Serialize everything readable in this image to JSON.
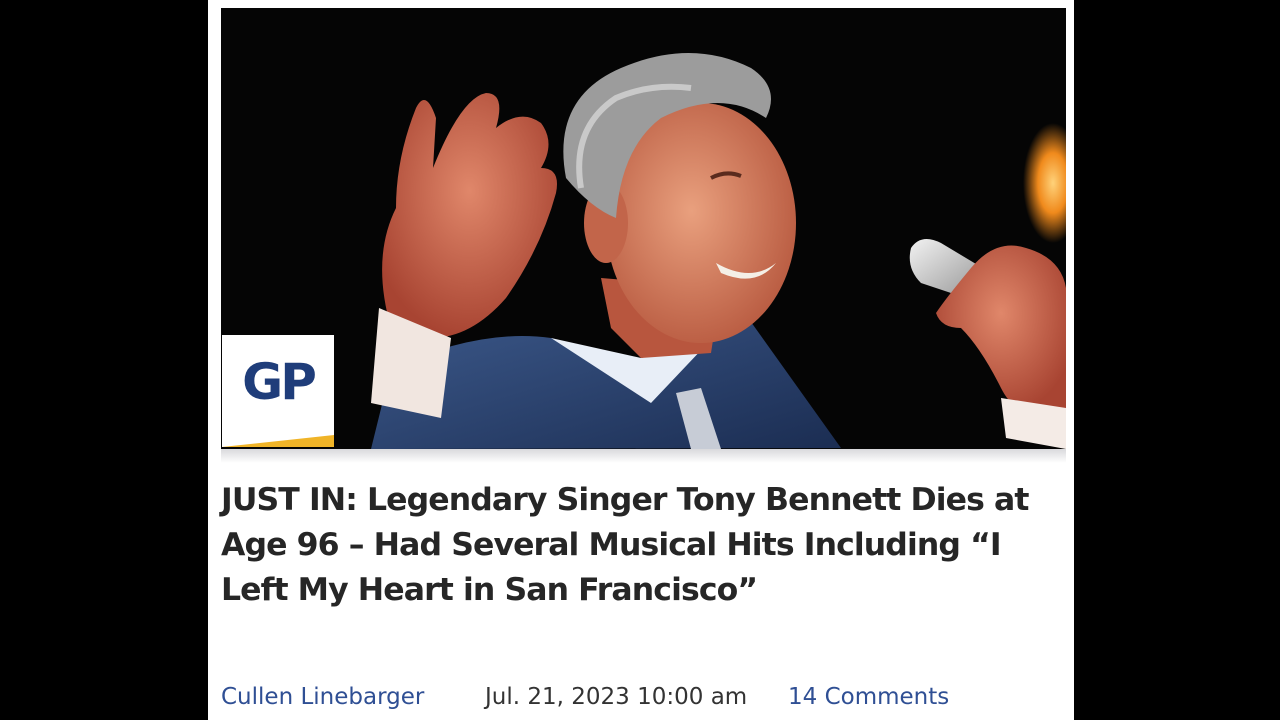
{
  "site": {
    "logo_text": "GP"
  },
  "article": {
    "headline": "JUST IN: Legendary Singer Tony Bennett Dies at Age 96 – Had Several Musical Hits Including “I Left My Heart in San Francisco”",
    "author": "Cullen Linebarger",
    "date": "Jul. 21, 2023 10:00 am",
    "comments": "14 Comments"
  },
  "colors": {
    "page_background": "#000000",
    "card_background": "#ffffff",
    "headline_text": "#262626",
    "link_blue": "#2f4f94",
    "logo_blue": "#1f3d7a",
    "logo_accent": "#f0b428"
  },
  "icons": {
    "site_logo": "gp-logo"
  }
}
